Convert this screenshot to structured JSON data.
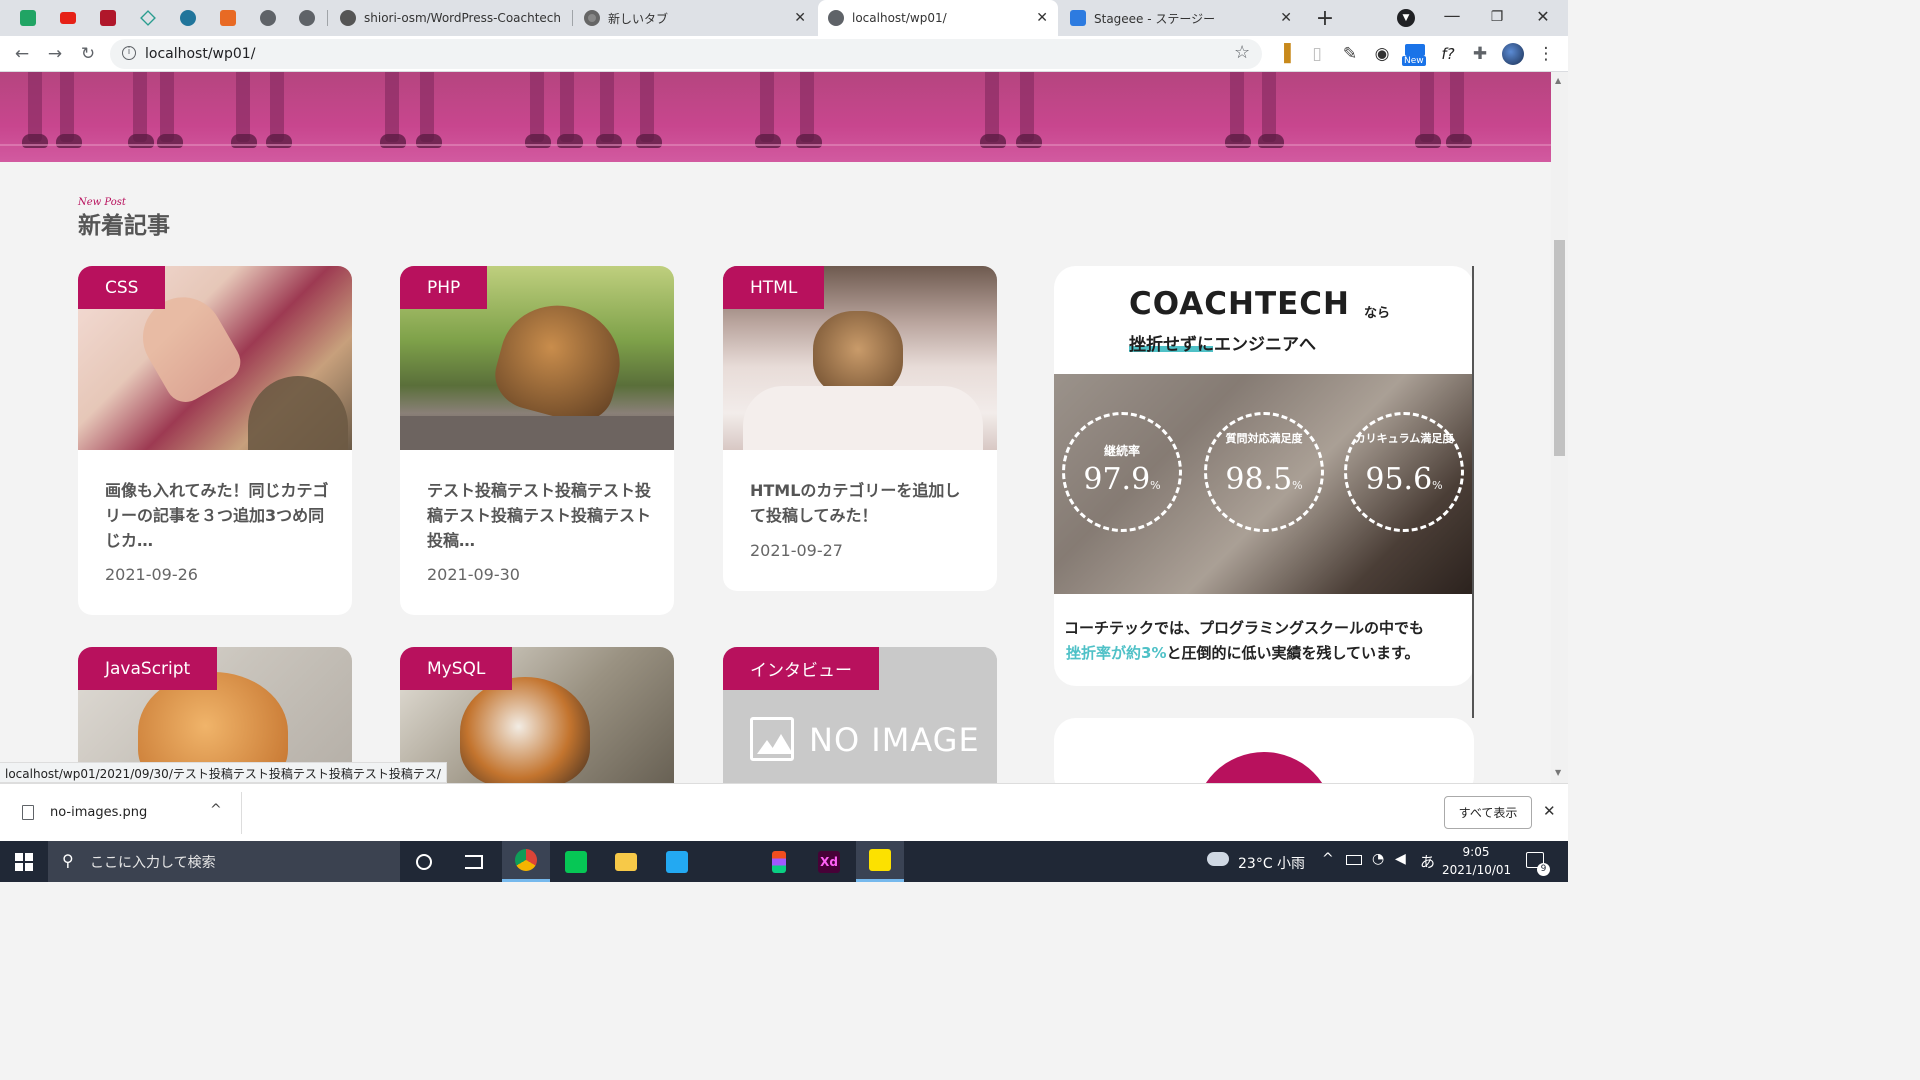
{
  "browser": {
    "tabs": [
      {
        "title": "shiori-osm/WordPress-Coachtech",
        "icon": "github-icon"
      },
      {
        "title": "新しいタブ",
        "icon": "chrome-icon"
      },
      {
        "title": "localhost/wp01/",
        "icon": "globe-icon",
        "active": true
      },
      {
        "title": "Stageee - ステージー",
        "icon": "stageee-icon"
      }
    ],
    "address": "localhost/wp01/",
    "extension_badge": "New",
    "extension_label": "f?",
    "status_url": "localhost/wp01/2021/09/30/テスト投稿テスト投稿テスト投稿テスト投稿テス/"
  },
  "section": {
    "subtitle": "New Post",
    "title": "新着記事"
  },
  "posts": [
    {
      "category": "CSS",
      "title": "画像も入れてみた！同じカテゴリーの記事を３つ追加3つめ同じカ…",
      "date": "2021-09-26"
    },
    {
      "category": "PHP",
      "title": "テスト投稿テスト投稿テスト投稿テスト投稿テスト投稿テスト投稿…",
      "date": "2021-09-30"
    },
    {
      "category": "HTML",
      "title": "HTMLのカテゴリーを追加して投稿してみた！",
      "date": "2021-09-27"
    },
    {
      "category": "JavaScript"
    },
    {
      "category": "MySQL"
    },
    {
      "category": "インタビュー",
      "no_image": "NO IMAGE"
    }
  ],
  "ad": {
    "brand": "COACHTECH",
    "brand_suffix": "なら",
    "tagline": "挫折せずにエンジニアへ",
    "stats": [
      {
        "label": "継続率",
        "value": "97.9",
        "unit": "%"
      },
      {
        "label": "質問対応満足度",
        "value": "98.5",
        "unit": "%"
      },
      {
        "label": "カリキュラム満足度",
        "value": "95.6",
        "unit": "%"
      }
    ],
    "body_1": "コーチテックでは、プログラミングスクールの中でも",
    "body_highlight": "挫折率が約3%",
    "body_2": "と圧倒的に低い実績を残しています。"
  },
  "download": {
    "file": "no-images.png",
    "show_all": "すべて表示"
  },
  "taskbar": {
    "search_placeholder": "ここに入力して検索",
    "weather": "23°C 小雨",
    "ime": "あ",
    "time": "9:05",
    "date": "2021/10/01",
    "notifications": "9"
  },
  "colors": {
    "accent": "#b8115d",
    "teal": "#4fc1c7"
  }
}
